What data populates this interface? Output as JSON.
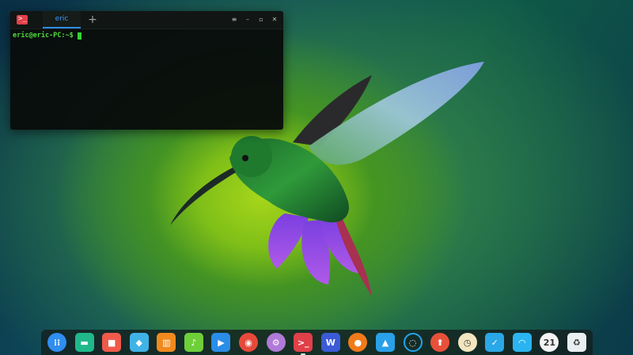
{
  "terminal": {
    "tab_label": "eric",
    "new_tab": "+",
    "prompt": "eric@eric-PC:~$",
    "controls": [
      "≡",
      "–",
      "▫",
      "✕"
    ]
  },
  "dock": {
    "items": [
      {
        "name": "launcher-icon",
        "color": "#2f8ef0"
      },
      {
        "name": "file-manager-icon",
        "color": "#20b88a"
      },
      {
        "name": "screen-recorder-icon",
        "color": "#ef5a4a"
      },
      {
        "name": "app-store-icon",
        "color": "#3fb3e6"
      },
      {
        "name": "archive-manager-icon",
        "color": "#f08a1e"
      },
      {
        "name": "music-icon",
        "color": "#6fcf3a"
      },
      {
        "name": "video-player-icon",
        "color": "#2a8de8"
      },
      {
        "name": "chrome-icon",
        "color": "#e64a3a"
      },
      {
        "name": "settings-icon",
        "color": "#b07ad8"
      },
      {
        "name": "terminal-icon",
        "color": "#e0404a"
      },
      {
        "name": "wps-writer-icon",
        "color": "#3b5bd6"
      },
      {
        "name": "firefox-icon",
        "color": "#f07a1a"
      },
      {
        "name": "image-viewer-icon",
        "color": "#2aa0e8"
      },
      {
        "name": "system-monitor-icon",
        "color": "#1fa6f0"
      },
      {
        "name": "downloader-icon",
        "color": "#e8503a"
      },
      {
        "name": "clock-icon",
        "color": "#f2e6c0"
      },
      {
        "name": "screenshot-icon",
        "color": "#2aa7e6"
      },
      {
        "name": "wifi-icon",
        "color": "#2ab4f0"
      },
      {
        "name": "datetime-icon",
        "color": "#f4f4f4"
      },
      {
        "name": "trash-icon",
        "color": "#e9eef0"
      }
    ]
  }
}
